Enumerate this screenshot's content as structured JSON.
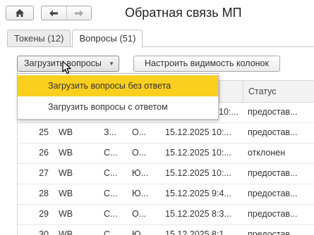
{
  "window": {
    "title": "Обратная связь МП"
  },
  "nav": {
    "home_icon": "home-icon",
    "back_icon": "arrow-left-icon",
    "forward_icon": "arrow-right-icon"
  },
  "tabs": [
    {
      "label": "Токены (12)",
      "active": false
    },
    {
      "label": "Вопросы (51)",
      "active": true
    }
  ],
  "toolbar": {
    "load_label": "Загрузить вопросы",
    "load_arrow": "▼",
    "columns_label": "Настроить видимость колонок"
  },
  "grid": {
    "columns": [
      "",
      "",
      "",
      "",
      "",
      "Статус"
    ],
    "rows": [
      {
        "num": "",
        "mp": "",
        "a": "",
        "b": "",
        "date": "10:...",
        "status": "предостав..."
      },
      {
        "num": "25",
        "mp": "WB",
        "a": "З...",
        "b": "О...",
        "date": "15.12.2025 10:...",
        "status": "предостав..."
      },
      {
        "num": "26",
        "mp": "WB",
        "a": "С...",
        "b": "О...",
        "date": "15.12.2025 10:...",
        "status": "отклонен"
      },
      {
        "num": "27",
        "mp": "WB",
        "a": "С...",
        "b": "Ю...",
        "date": "15.12.2025 10:...",
        "status": "предостав..."
      },
      {
        "num": "28",
        "mp": "WB",
        "a": "С...",
        "b": "Ю...",
        "date": "15.12.2025 9:4...",
        "status": "предостав..."
      },
      {
        "num": "29",
        "mp": "WB",
        "a": "С...",
        "b": "О...",
        "date": "15.12.2025 8:3...",
        "status": "предостав..."
      },
      {
        "num": "30",
        "mp": "WB",
        "a": "С...",
        "b": "Ю...",
        "date": "15.12.2025 8:1...",
        "status": "предостав..."
      }
    ]
  },
  "dropdown": {
    "items": [
      {
        "label": "Загрузить вопросы без ответа",
        "highlighted": true
      },
      {
        "label": "Загрузить вопросы с ответом",
        "highlighted": false
      }
    ]
  },
  "colors": {
    "highlight": "#fbcf1e",
    "border": "#a9a9a9",
    "header_bg": "#f2f2f2"
  }
}
